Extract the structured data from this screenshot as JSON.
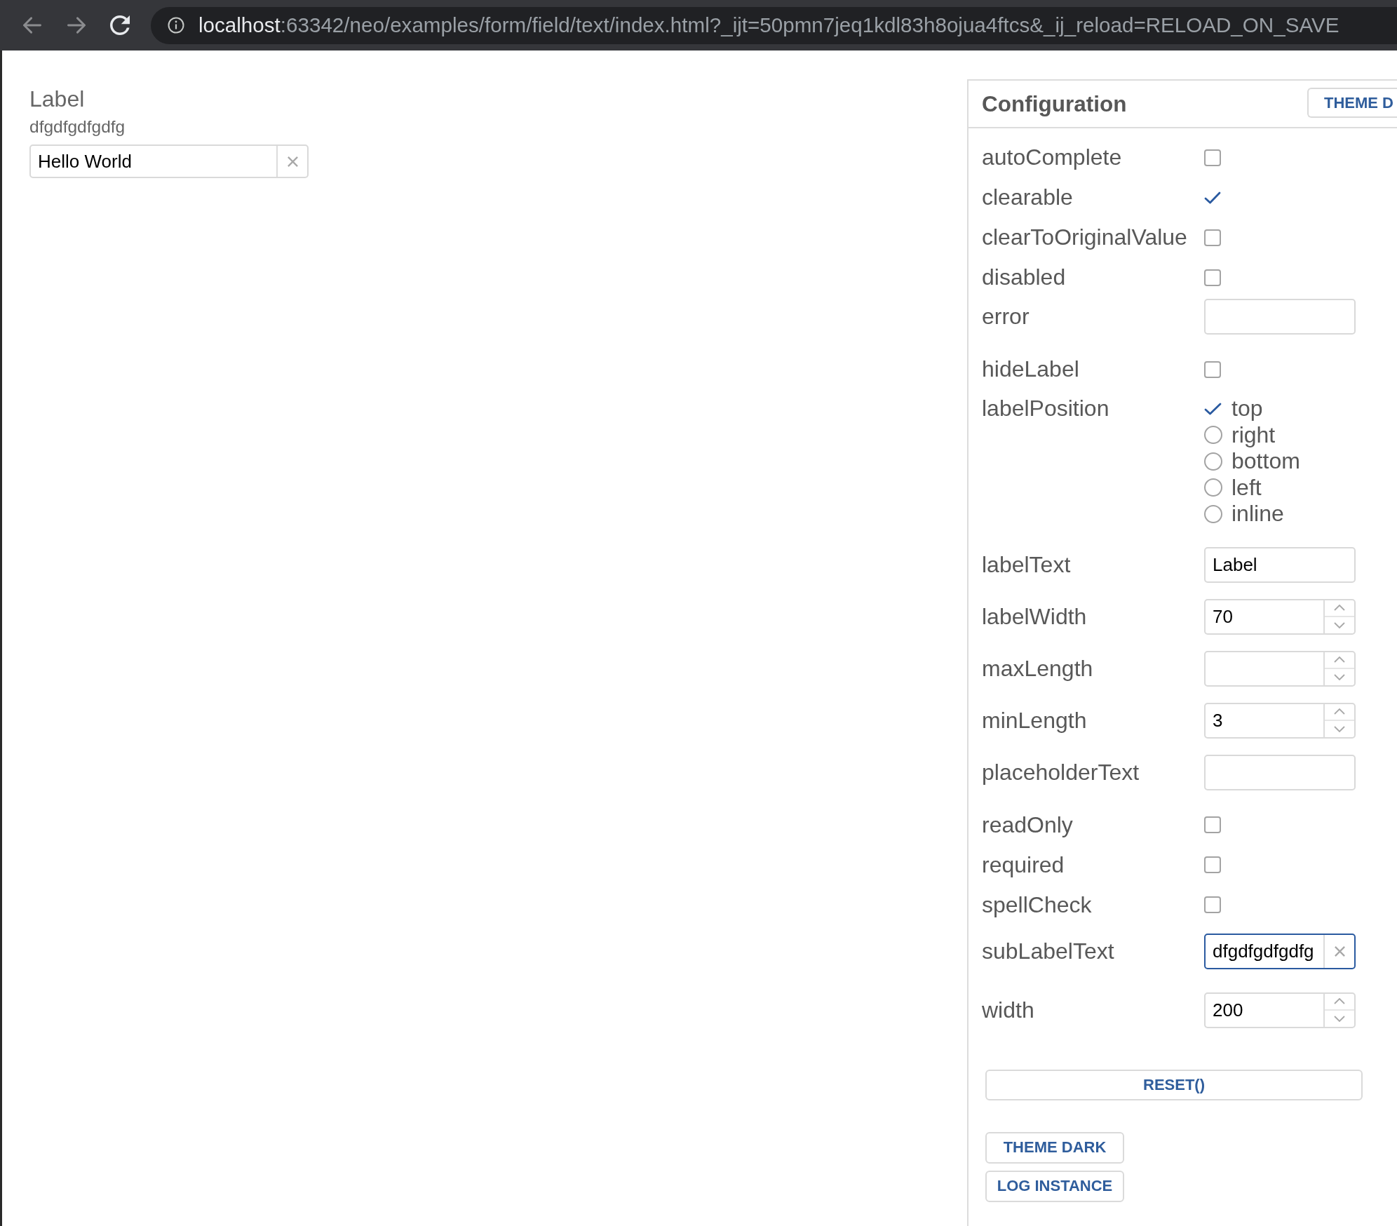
{
  "browser": {
    "back": {
      "disabled": true
    },
    "forward": {
      "disabled": true
    },
    "url": {
      "host": "localhost",
      "rest": ":63342/neo/examples/form/field/text/index.html?_ijt=50pmn7jeq1kdl83h8ojua4ftcs&_ij_reload=RELOAD_ON_SAVE"
    }
  },
  "field": {
    "label": "Label",
    "sub_label": "dfgdfgdfgdfg",
    "value": "Hello World",
    "clearable": true
  },
  "config": {
    "title": "Configuration",
    "header_button": "THEME D",
    "rows": [
      {
        "kind": "checkbox",
        "label": "autoComplete",
        "checked": false
      },
      {
        "kind": "checkbox",
        "label": "clearable",
        "checked": true
      },
      {
        "kind": "checkbox",
        "label": "clearToOriginalValue",
        "checked": false
      },
      {
        "kind": "checkbox",
        "label": "disabled",
        "checked": false
      },
      {
        "kind": "text",
        "label": "error",
        "focused": false,
        "clearable": false
      },
      {
        "kind": "checkbox",
        "label": "hideLabel",
        "checked": false
      },
      {
        "kind": "radio",
        "label": "labelPosition",
        "options": [
          {
            "label": "top",
            "selected": true
          },
          {
            "label": "right",
            "selected": false
          },
          {
            "label": "bottom",
            "selected": false
          },
          {
            "label": "left",
            "selected": false
          },
          {
            "label": "inline",
            "selected": false
          }
        ]
      },
      {
        "kind": "text",
        "label": "labelText",
        "value": "Label",
        "focused": false,
        "clearable": false
      },
      {
        "kind": "number",
        "label": "labelWidth",
        "value": "70",
        "focused": false
      },
      {
        "kind": "number",
        "label": "maxLength",
        "focused": false
      },
      {
        "kind": "number",
        "label": "minLength",
        "value": "3",
        "focused": false
      },
      {
        "kind": "text",
        "label": "placeholderText",
        "focused": false,
        "clearable": false
      },
      {
        "kind": "checkbox",
        "label": "readOnly",
        "checked": false
      },
      {
        "kind": "checkbox",
        "label": "required",
        "checked": false
      },
      {
        "kind": "checkbox",
        "label": "spellCheck",
        "checked": false
      },
      {
        "kind": "text",
        "label": "subLabelText",
        "value": "dfgdfgdfgdfg",
        "focused": true,
        "clearable": true
      },
      {
        "kind": "number",
        "label": "width",
        "value": "200",
        "focused": false
      }
    ],
    "reset_button": "RESET()",
    "buttons": [
      "THEME DARK",
      "LOG INSTANCE"
    ]
  }
}
